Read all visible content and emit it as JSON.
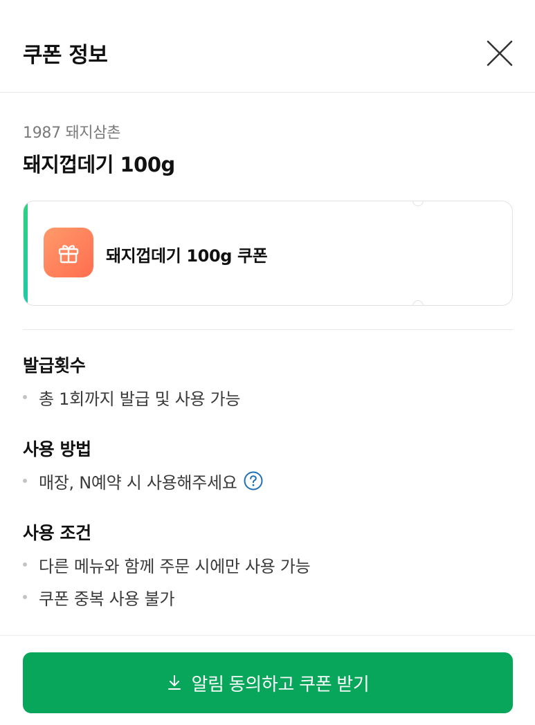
{
  "header": {
    "title": "쿠폰 정보",
    "close_icon": "close-icon"
  },
  "store": {
    "name": "1987 돼지삼촌",
    "product": "돼지껍데기 100g"
  },
  "coupon": {
    "label": "돼지껍데기 100g 쿠폰",
    "icon": "gift-icon",
    "accent_color": "#2fd07f",
    "icon_color": "#ff7a55"
  },
  "sections": {
    "issue": {
      "title": "발급횟수",
      "items": [
        "총 1회까지 발급 및 사용 가능"
      ]
    },
    "usage": {
      "title": "사용 방법",
      "items": [
        "매장, N예약 시 사용해주세요"
      ],
      "help_icon": "help-icon"
    },
    "conditions": {
      "title": "사용 조건",
      "items": [
        "다른 메뉴와 함께 주문 시에만 사용 가능",
        "쿠폰 중복 사용 불가"
      ]
    }
  },
  "cta": {
    "label": "알림 동의하고 쿠폰 받기",
    "icon": "download-icon",
    "color": "#08a65a"
  }
}
